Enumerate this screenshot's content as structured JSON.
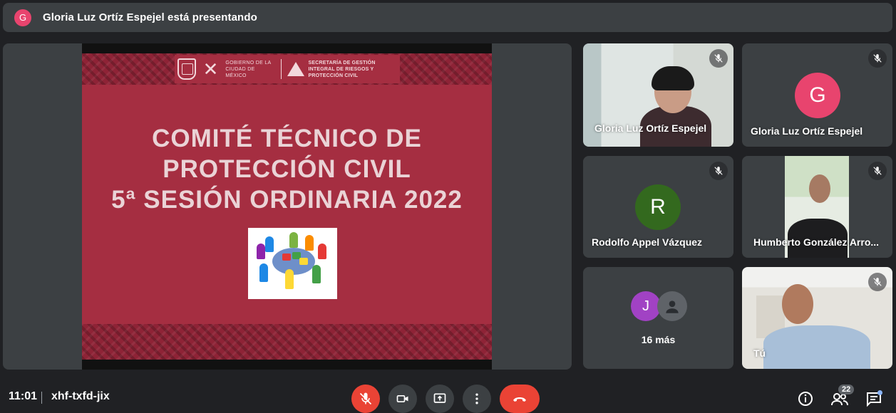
{
  "presenter_banner": {
    "avatar_letter": "G",
    "text": "Gloria Luz Ortíz Espejel está presentando"
  },
  "slide": {
    "logo_gobierno": "GOBIERNO DE LA CIUDAD DE MÉXICO",
    "logo_secretaria": "SECRETARÍA DE GESTIÓN INTEGRAL DE RIESGOS Y PROTECCIÓN CIVIL",
    "title_line1": "COMITÉ TÉCNICO DE",
    "title_line2": "PROTECCIÓN CIVIL",
    "title_line3": "5ª SESIÓN ORDINARIA 2022"
  },
  "participants": [
    {
      "name": "Gloria Luz Ortíz Espejel",
      "video": true
    },
    {
      "name": "Gloria Luz Ortíz Espejel",
      "avatar_letter": "G",
      "avatar_color": "#e8446e"
    },
    {
      "name": "Rodolfo Appel Vázquez",
      "avatar_letter": "R",
      "avatar_color": "#33691e"
    },
    {
      "name": "Humberto González Arro...",
      "video": true
    },
    {
      "avatar_letter": "J",
      "avatar_color": "#a142c4",
      "more_label": "16 más"
    },
    {
      "name": "Tú",
      "video": true
    }
  ],
  "bottom_bar": {
    "time": "11:01",
    "meeting_code": "xhf-txfd-jix",
    "people_count": "22"
  },
  "colors": {
    "background": "#202124",
    "tile": "#3c4043",
    "danger": "#ea4335",
    "slide": "#a52e41"
  }
}
